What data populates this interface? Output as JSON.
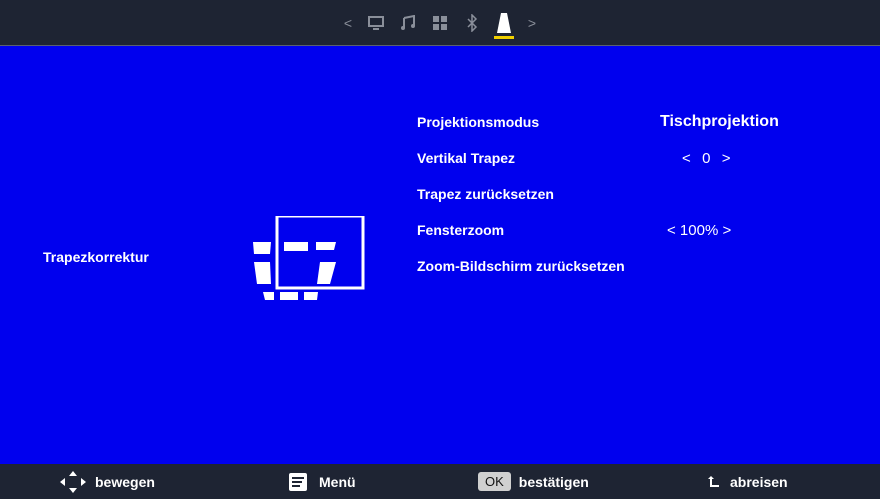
{
  "top_nav": {
    "left_arrow": "<",
    "right_arrow": ">",
    "tabs": [
      {
        "icon": "monitor-icon"
      },
      {
        "icon": "music-icon"
      },
      {
        "icon": "grid-icon"
      },
      {
        "icon": "bluetooth-icon"
      },
      {
        "icon": "projector-icon",
        "active": true
      }
    ]
  },
  "section": {
    "title": "Trapezkorrektur"
  },
  "settings": [
    {
      "label": "Projektionsmodus",
      "value": "Tischprojektion"
    },
    {
      "label": "Vertikal Trapez",
      "value": "<  0  >"
    },
    {
      "label": "Trapez zurücksetzen",
      "value": ""
    },
    {
      "label": "Fensterzoom",
      "value": "< 100% >"
    },
    {
      "label": "Zoom-Bildschirm zurücksetzen",
      "value": ""
    }
  ],
  "footer": {
    "move": "bewegen",
    "menu": "Menü",
    "ok_key": "OK",
    "confirm": "bestätigen",
    "back": "abreisen"
  },
  "colors": {
    "background": "#0000ee",
    "bar": "#1e2433",
    "accent": "#f0d000"
  }
}
